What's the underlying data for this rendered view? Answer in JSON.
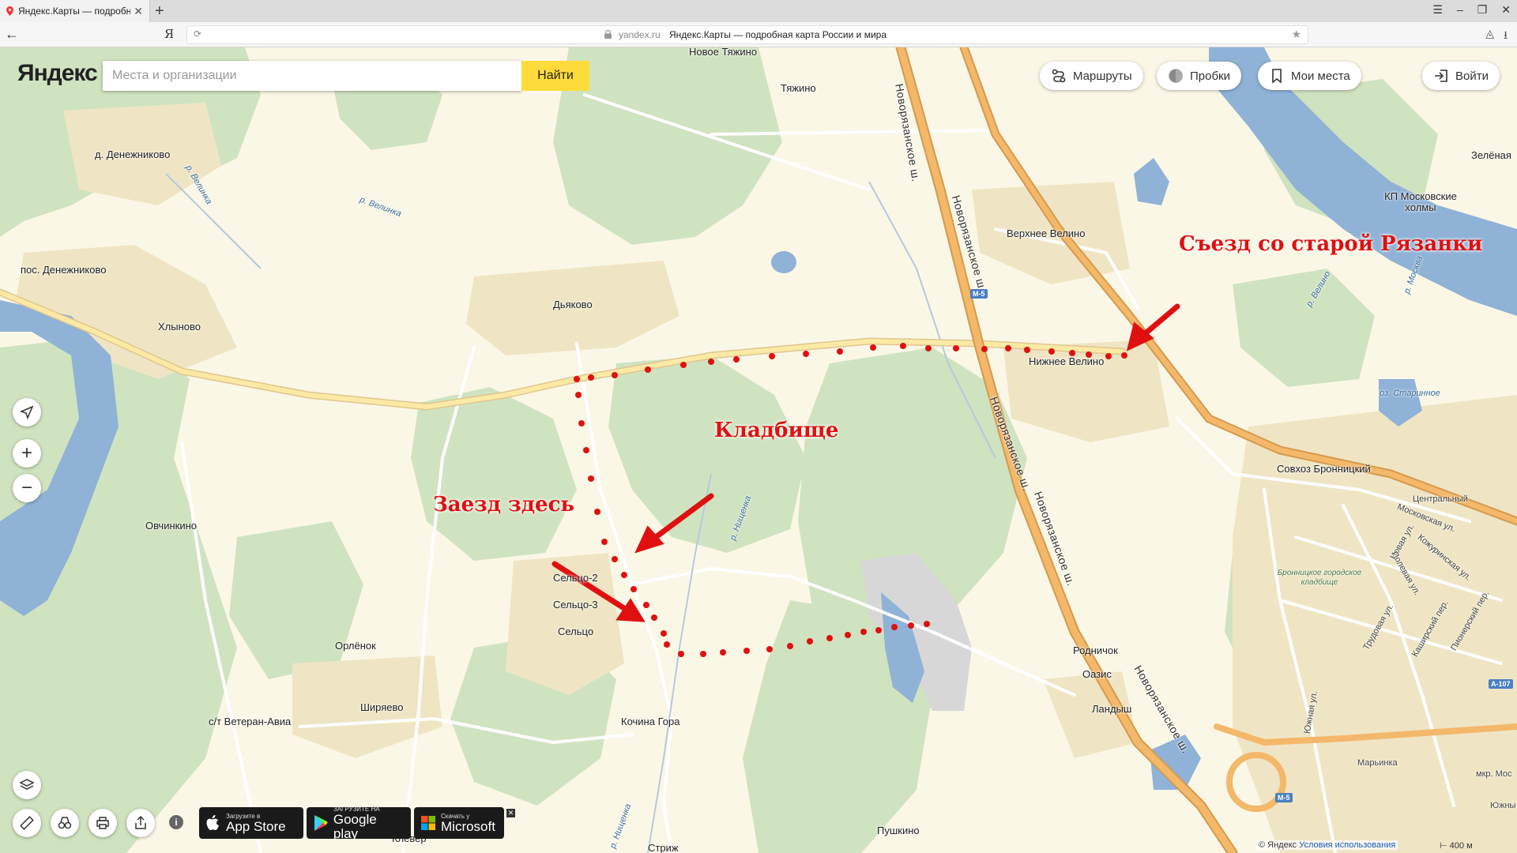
{
  "browser": {
    "tab_title": "Яндекс.Карты — подробная карта",
    "tab_close": "✕",
    "new_tab": "+",
    "window_controls": [
      "☰",
      "–",
      "❐",
      "✕"
    ],
    "ya_button": "Я",
    "domain": "yandex.ru",
    "page_title": "Яндекс.Карты — подробная карта России и мира",
    "reload": "⟳",
    "star": "★"
  },
  "header": {
    "logo": "Яндекс",
    "search_placeholder": "Места и организации",
    "search_button": "Найти",
    "routes": "Маршруты",
    "traffic": "Пробки",
    "my_places": "Мои места",
    "login": "Войти"
  },
  "map": {
    "places": [
      "Новое Тяжино",
      "Тяжино",
      "д. Денежниково",
      "пос. Денежниково",
      "Хлыново",
      "Дьяково",
      "Верхнее Велино",
      "Нижнее Велино",
      "Зелёная",
      "КП Московские холмы",
      "Совхоз Бронницкий",
      "Центральный",
      "Овчинкино",
      "Сельцо-2",
      "Сельцо-3",
      "Сельцо",
      "Орлёнок",
      "Ширяево",
      "с/т Ветеран-Авиа",
      "Кочина Гора",
      "Родничок",
      "Оазис",
      "Ландыш",
      "Марьинка",
      "Пушкино",
      "Клевер",
      "Стриж",
      "Южны"
    ],
    "water": [
      "р. Велинка",
      "р. Велинка",
      "р. Велино",
      "р. Москва",
      "р. Нищенка",
      "р. Нищенка",
      "оз. Старинное"
    ],
    "roads": [
      "Новорязанское ш.",
      "Новорязанское ш.",
      "Новорязанское ш.",
      "Новорязанское ш.",
      "Новорязанское ш.",
      "Московская ул.",
      "Кожуринская ул.",
      "Новая ул.",
      "Полевая ул.",
      "Трудовая ул.",
      "Каширский пер.",
      "Пионерский пер.",
      "Южная ул.",
      "мкр. Мос"
    ],
    "shields": [
      "М-5",
      "М-5",
      "А-107"
    ],
    "cemetery_label": "Бронницкое городское кладбище"
  },
  "annotations": {
    "exit": "Съезд со старой Рязанки",
    "cemetery": "Кладбище",
    "entry": "Заезд здесь",
    "color": "#e01010"
  },
  "map_controls": {
    "locate": "➤",
    "zoom_in": "+",
    "zoom_out": "−"
  },
  "stores": [
    {
      "small": "Загрузите в",
      "big": "App Store"
    },
    {
      "small": "ЗАГРУЗИТЕ НА",
      "big": "Google play"
    },
    {
      "small": "Скачать у",
      "big": "Microsoft"
    }
  ],
  "store_close": "✕",
  "footer": {
    "copyright": "© Яндекс",
    "terms": "Условия использования",
    "scale": "400 м"
  },
  "colors": {
    "land": "#fbf7e6",
    "forest": "#cfe3c0",
    "water": "#8fb2d6",
    "highway": "#f3b86a",
    "search_button": "#fddb3a"
  }
}
